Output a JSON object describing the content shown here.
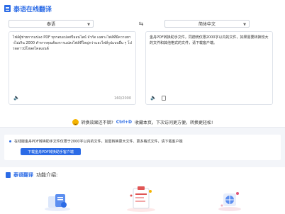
{
  "header": {
    "title": "泰语在线翻译"
  },
  "language_bar": {
    "source_lang": "泰语",
    "target_lang": "简体中文"
  },
  "source_panel": {
    "text": "ไฟล์ผู้ช่วยการแปลง PDF ทุกรอบแปลฟรีออนไลน์ จำกัด เฉพาะไฟล์ที่มีความยาวไม่เกิน 2000 คำหากคุณต้องการแปลงไฟล์ที่ใหญ่กว่าและไฟล์รูปแบบอื่น ๆ โปรดดาวน์โหลดไคลเอนต์",
    "char_count": "160/2000"
  },
  "target_panel": {
    "text": "金舟PDF转换助手文件，同德统仅限2000字以内的文件，如果需要转换较大的文件和其他格式的文件，请下载客户端。"
  },
  "promo": {
    "text_before": "转换效果还不错?",
    "hotkey": "Ctrl+D",
    "text_after": "收藏本页，下次访问更方便，转换更轻松!"
  },
  "notice": {
    "text": "在线版金舟PDF转换助手文件仅限于2000字以内的文件，如需转换更大文件、更多格式文件，请下载客户端",
    "button_label": "下载金舟PDF转换助手客户端"
  },
  "features": {
    "brand": "泰语翻译",
    "subtitle": "功能介绍:"
  },
  "colors": {
    "accent": "#2b6be6",
    "page_bg": "#f3f5f9"
  }
}
